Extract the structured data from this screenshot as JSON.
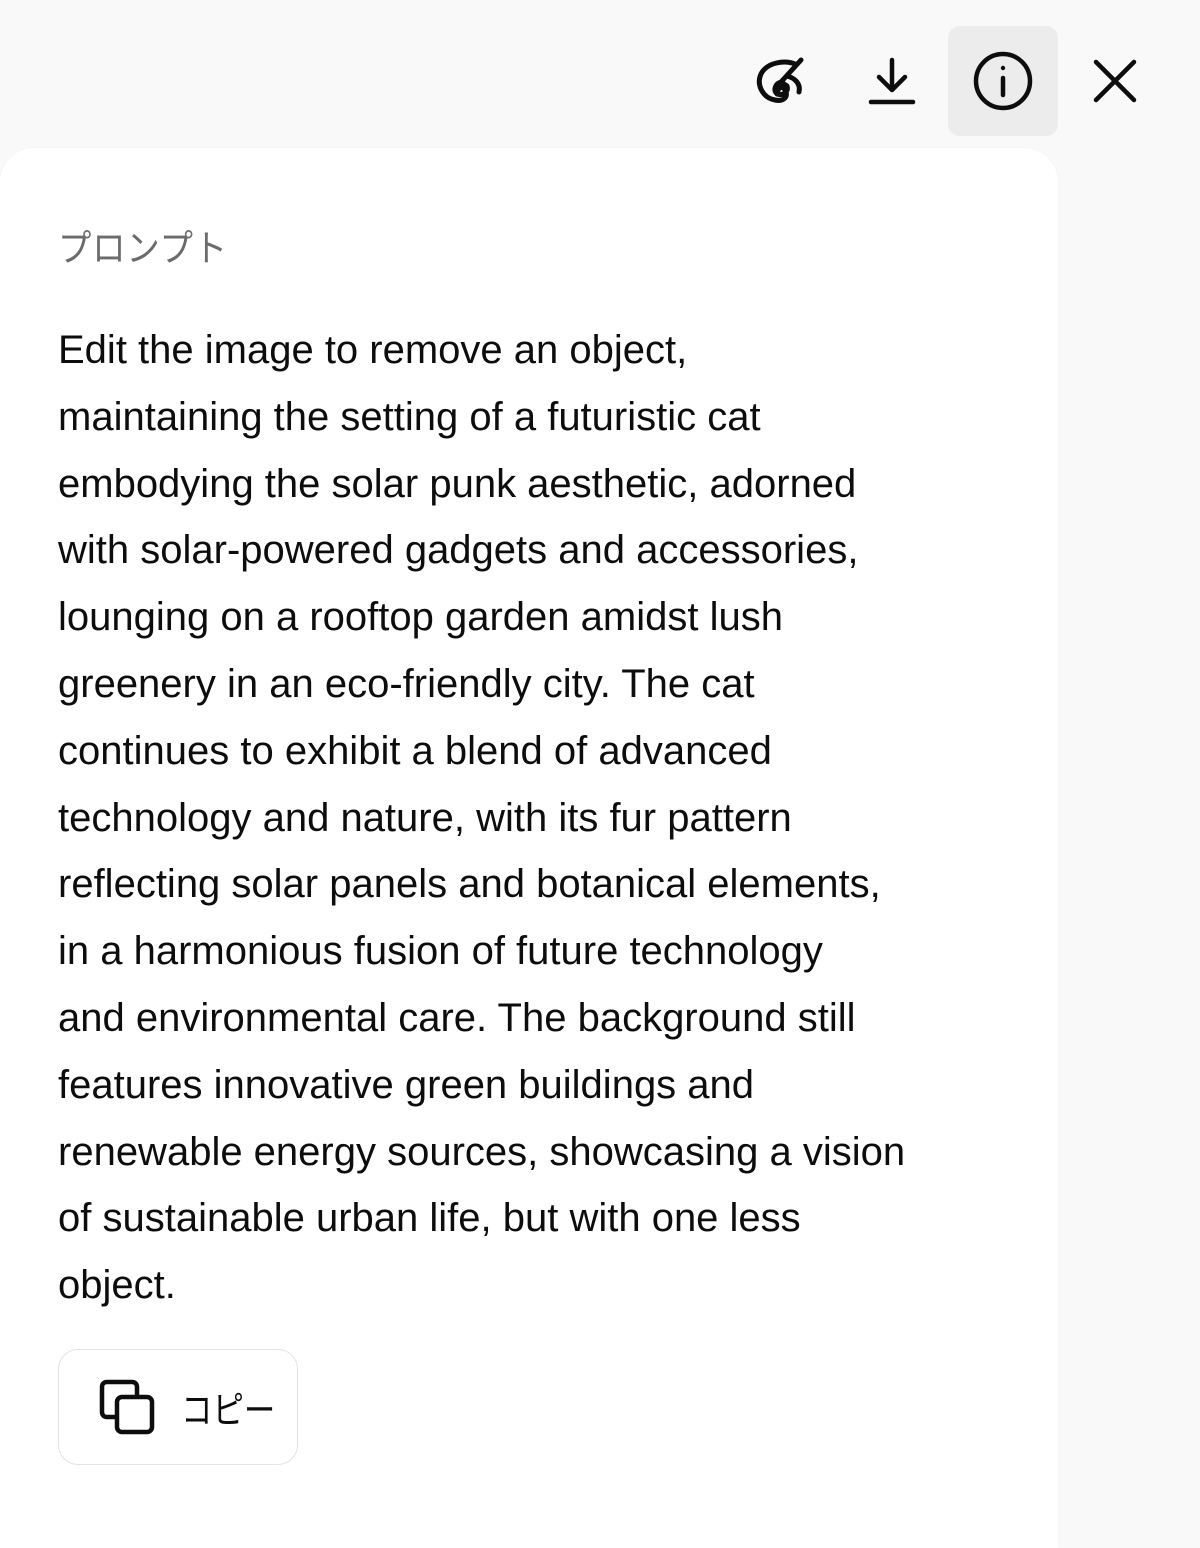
{
  "toolbar": {
    "buttons": [
      {
        "name": "edit-image",
        "icon": "paint-brush-icon",
        "active": false
      },
      {
        "name": "download",
        "icon": "download-icon",
        "active": false
      },
      {
        "name": "info",
        "icon": "info-icon",
        "active": true
      },
      {
        "name": "close",
        "icon": "close-icon",
        "active": false
      }
    ],
    "active_color": "#ececec",
    "icon_color": "#0d0d0d"
  },
  "panel": {
    "label": "プロンプト",
    "prompt_text": "Edit the image to remove an object,\nmaintaining the setting of a futuristic cat\nembodying the solar punk aesthetic, adorned\nwith solar-powered gadgets and accessories,\nlounging on a rooftop garden amidst lush\ngreenery in an eco-friendly city. The cat\ncontinues to exhibit a blend of advanced\ntechnology and nature, with its fur pattern\nreflecting solar panels and botanical elements,\nin a harmonious fusion of future technology\nand environmental care. The background still\nfeatures innovative green buildings and\nrenewable energy sources, showcasing a vision\nof sustainable urban life, but with one less\nobject.",
    "copy_button": {
      "label": "コピー",
      "icon": "copy-icon"
    }
  },
  "colors": {
    "page_background": "#f9f9f9",
    "panel_background": "#ffffff",
    "label_text": "#6b6b6b",
    "body_text": "#0d0d0d"
  }
}
